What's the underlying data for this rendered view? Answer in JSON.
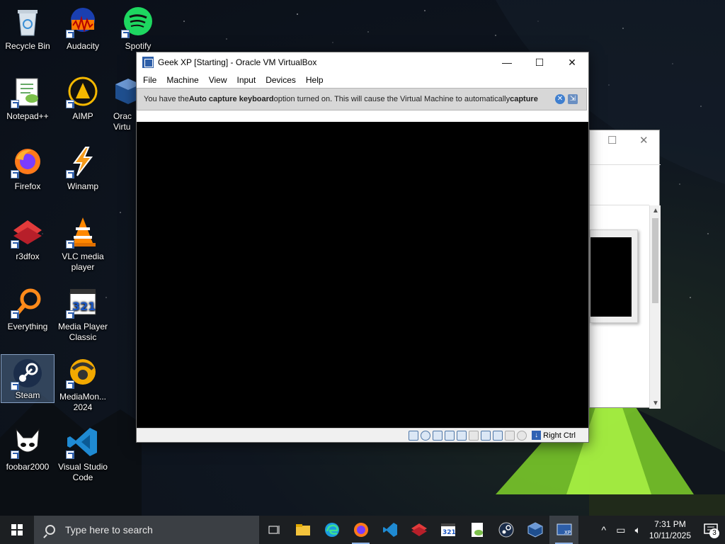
{
  "desktop": {
    "icons": [
      {
        "label": "Recycle Bin",
        "icon": "recycle-bin-icon"
      },
      {
        "label": "Audacity",
        "icon": "audacity-icon"
      },
      {
        "label": "Spotify",
        "icon": "spotify-icon"
      },
      {
        "label": "Notepad++",
        "icon": "notepad-plus-plus-icon"
      },
      {
        "label": "AIMP",
        "icon": "aimp-icon"
      },
      {
        "label": "Orac Virtu",
        "icon": "virtualbox-icon"
      },
      {
        "label": "Firefox",
        "icon": "firefox-icon"
      },
      {
        "label": "Winamp",
        "icon": "winamp-icon"
      },
      {
        "label": "r3dfox",
        "icon": "r3dfox-icon"
      },
      {
        "label": "VLC media player",
        "icon": "vlc-icon"
      },
      {
        "label": "Everything",
        "icon": "everything-search-icon"
      },
      {
        "label": "Media Player Classic",
        "icon": "mpc-icon"
      },
      {
        "label": "Steam",
        "icon": "steam-icon",
        "selected": true
      },
      {
        "label": "MediaMon... 2024",
        "icon": "mediamonkey-icon"
      },
      {
        "label": "foobar2000",
        "icon": "foobar2000-icon"
      },
      {
        "label": "Visual Studio Code",
        "icon": "vscode-icon"
      }
    ]
  },
  "vbox": {
    "title": "Geek XP [Starting] - Oracle VM VirtualBox",
    "controls": {
      "minimize": "—",
      "maximize": "☐",
      "close": "✕"
    },
    "menu": [
      "File",
      "Machine",
      "View",
      "Input",
      "Devices",
      "Help"
    ],
    "notice": {
      "pre": "You have the ",
      "bold1": "Auto capture keyboard",
      "mid": " option turned on. This will cause the Virtual Machine to automatically ",
      "bold2": "capture"
    },
    "host_key": "Right Ctrl"
  },
  "bg_window": {
    "maximize": "☐",
    "close": "✕"
  },
  "taskbar": {
    "search_placeholder": "Type here to search",
    "apps": [
      "task-view-icon",
      "file-explorer-icon",
      "edge-icon",
      "firefox-icon",
      "vscode-icon",
      "r3dfox-icon",
      "mpc-icon",
      "notepad-plus-plus-icon",
      "steam-icon",
      "virtualbox-icon",
      "virtualbox-vm-icon"
    ],
    "time": "7:31 PM",
    "date": "10/11/2025",
    "notifications": "3"
  },
  "colors": {
    "taskbar": "#1c1f22",
    "search_box": "#3b3f44",
    "notice_bg": "#d7d7d7",
    "vm_screen": "#000000",
    "accent": "#2d5ea8"
  }
}
